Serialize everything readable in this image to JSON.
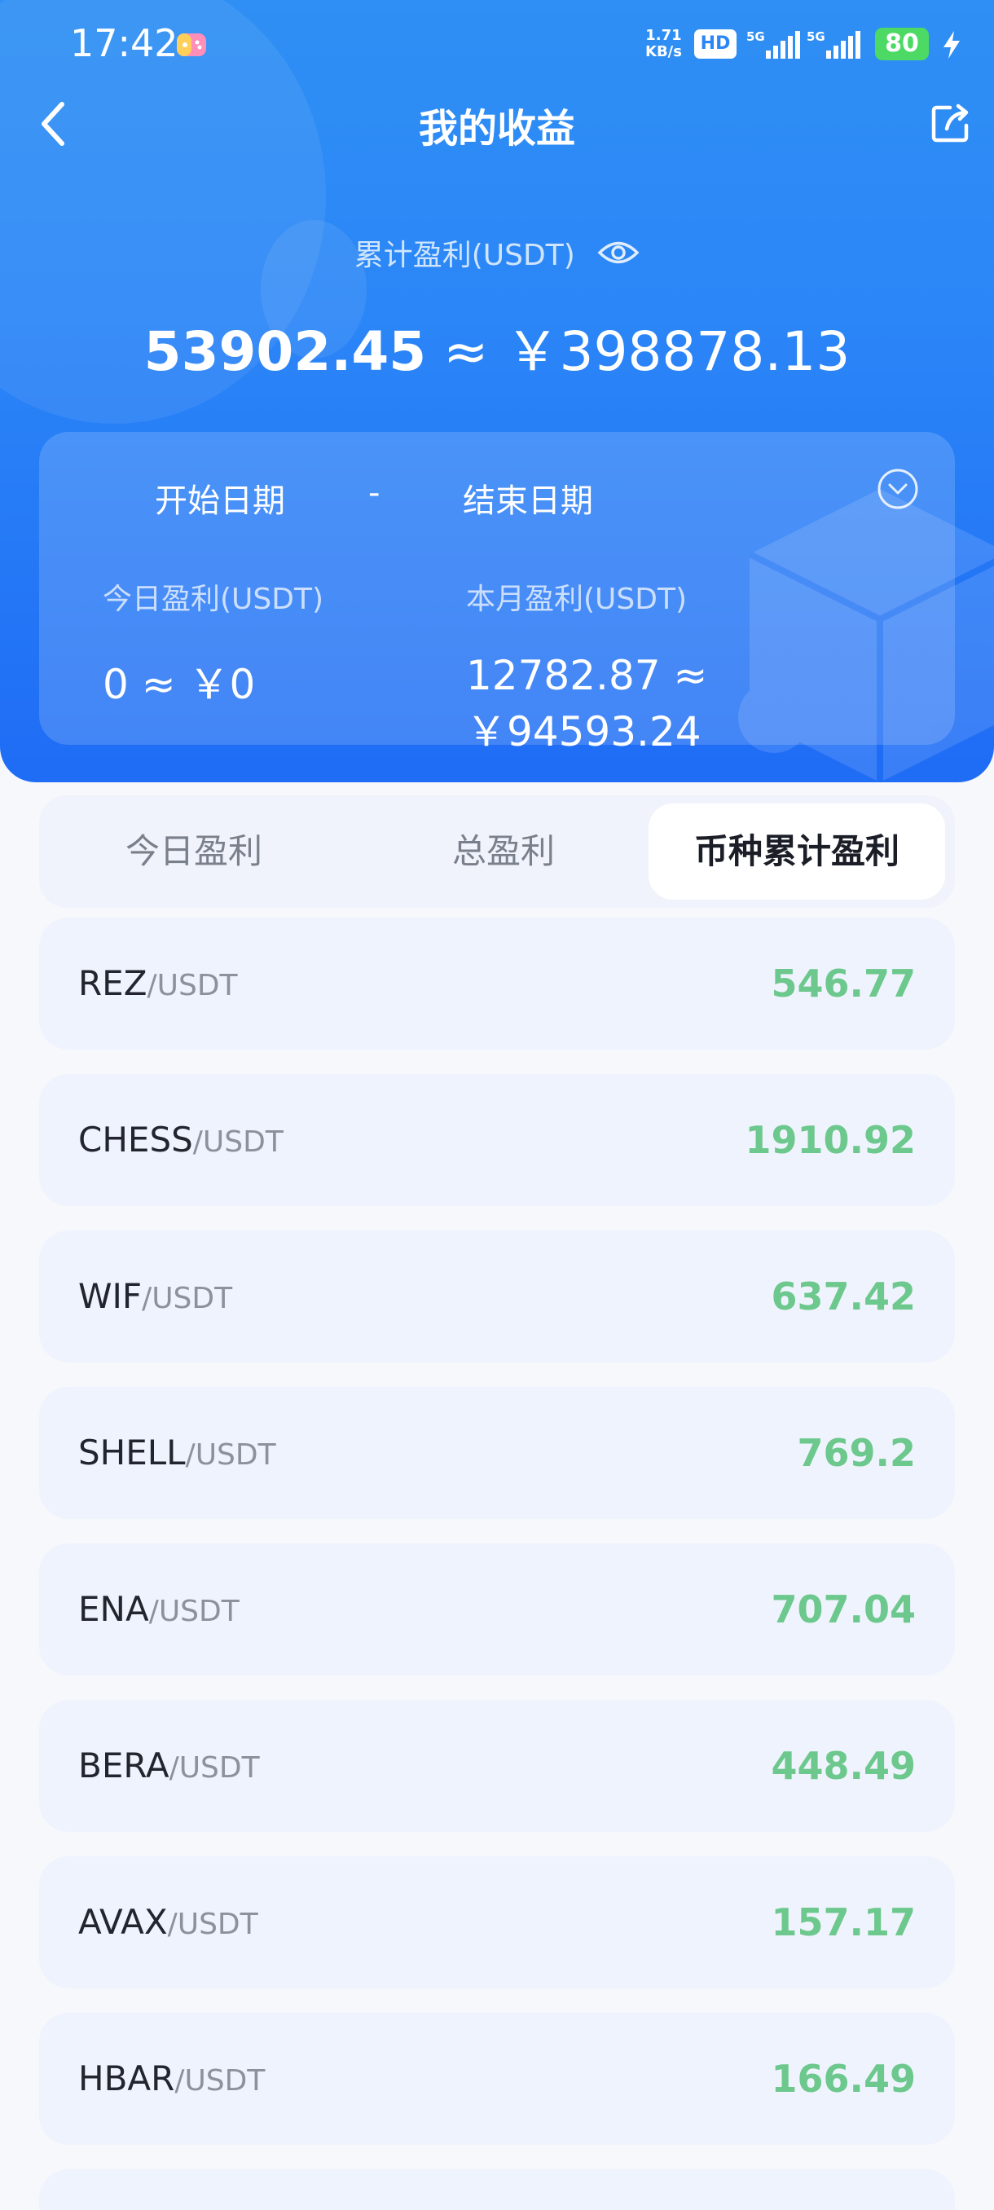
{
  "status_bar": {
    "time": "17:42",
    "net_speed_value": "1.71",
    "net_speed_unit": "KB/s",
    "hd_label": "HD",
    "signal1_label": "5G",
    "signal2_label": "5G",
    "battery": "80"
  },
  "header": {
    "title": "我的收益",
    "total_label": "累计盈利(USDT)",
    "total_usdt": "53902.45",
    "total_cny": " ≈ ￥398878.13"
  },
  "summary": {
    "start_date": "开始日期",
    "dash": "-",
    "end_date": "结束日期",
    "today_label": "今日盈利(USDT)",
    "today_value": "0 ≈ ￥0",
    "month_label": "本月盈利(USDT)",
    "month_value": "12782.87 ≈ ￥94593.24"
  },
  "tabs": {
    "today": "今日盈利",
    "total": "总盈利",
    "coin": "币种累计盈利",
    "selected": "coin"
  },
  "colors": {
    "accent_blue": "#2b86f7",
    "profit_green": "#6cc88c"
  },
  "rows": [
    {
      "base": "REZ",
      "quote": "/USDT",
      "profit": "546.77"
    },
    {
      "base": "CHESS",
      "quote": "/USDT",
      "profit": "1910.92"
    },
    {
      "base": "WIF",
      "quote": "/USDT",
      "profit": "637.42"
    },
    {
      "base": "SHELL",
      "quote": "/USDT",
      "profit": "769.2"
    },
    {
      "base": "ENA",
      "quote": "/USDT",
      "profit": "707.04"
    },
    {
      "base": "BERA",
      "quote": "/USDT",
      "profit": "448.49"
    },
    {
      "base": "AVAX",
      "quote": "/USDT",
      "profit": "157.17"
    },
    {
      "base": "HBAR",
      "quote": "/USDT",
      "profit": "166.49"
    }
  ]
}
